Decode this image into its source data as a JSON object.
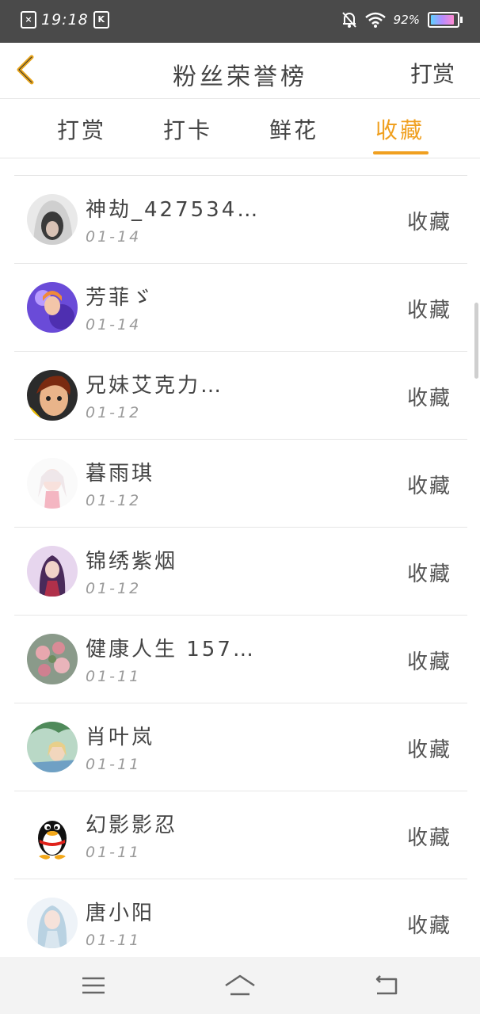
{
  "status_bar": {
    "time": "19:18",
    "left_badge": "K",
    "battery": "92%",
    "battery_level": 0.92,
    "icons": [
      "close-box-icon",
      "k-app-icon",
      "mute-bell-icon",
      "wifi-icon",
      "battery-icon"
    ]
  },
  "header": {
    "title": "粉丝荣誉榜",
    "action": "打赏",
    "back_icon": "chevron-left-icon",
    "accent": "#f0a020"
  },
  "tabs": [
    {
      "label": "打赏",
      "active": false
    },
    {
      "label": "打卡",
      "active": false
    },
    {
      "label": "鲜花",
      "active": false
    },
    {
      "label": "收藏",
      "active": true
    }
  ],
  "rows": [
    {
      "name": "神劫_427534…",
      "date": "01-14",
      "action": "收藏"
    },
    {
      "name": "芳菲ゞ",
      "date": "01-14",
      "action": "收藏"
    },
    {
      "name": "兄妹艾克力…",
      "date": "01-12",
      "action": "收藏"
    },
    {
      "name": "暮雨琪",
      "date": "01-12",
      "action": "收藏"
    },
    {
      "name": "锦绣紫烟",
      "date": "01-12",
      "action": "收藏"
    },
    {
      "name": "健康人生 157…",
      "date": "01-11",
      "action": "收藏"
    },
    {
      "name": "肖叶岚",
      "date": "01-11",
      "action": "收藏"
    },
    {
      "name": "幻影影忍",
      "date": "01-11",
      "action": "收藏"
    },
    {
      "name": "唐小阳",
      "date": "01-11",
      "action": "收藏"
    }
  ],
  "bottom_nav": [
    "menu-icon",
    "home-icon",
    "back-icon"
  ]
}
